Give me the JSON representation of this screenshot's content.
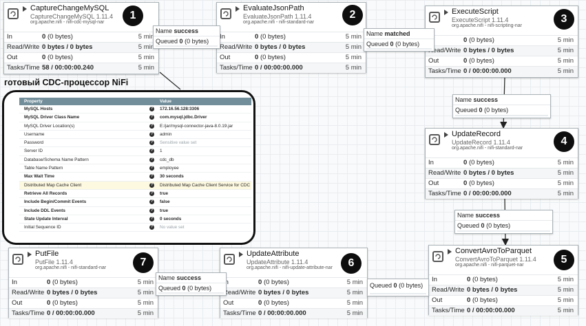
{
  "caption": "готовый CDC-процессор NiFi",
  "units": {
    "bytes": "(0 bytes)",
    "bytes_pair": "0 bytes / 0 bytes",
    "window": "5 min"
  },
  "row_labels": {
    "in": "In",
    "rw": "Read/Write",
    "out": "Out",
    "tasks": "Tasks/Time"
  },
  "queue_labels": {
    "name": "Name",
    "queued": "Queued"
  },
  "processors": [
    {
      "name": "CaptureChangeMySQL",
      "type": "CaptureChangeMySQL 1.11.4",
      "bundle": "org.apache.nifi - nifi-cdc-mysql-nar",
      "number": "1",
      "in": "0",
      "out": "0",
      "tasks": "58 / 00:00:00.240"
    },
    {
      "name": "EvaluateJsonPath",
      "type": "EvaluateJsonPath 1.11.4",
      "bundle": "org.apache.nifi - nifi-standard-nar",
      "number": "2",
      "in": "0",
      "out": "0",
      "tasks": "0 / 00:00:00.000"
    },
    {
      "name": "ExecuteScript",
      "type": "ExecuteScript 1.11.4",
      "bundle": "org.apache.nifi - nifi-scripting-nar",
      "number": "3",
      "in": "0",
      "out": "0",
      "tasks": "0 / 00:00:00.000"
    },
    {
      "name": "UpdateRecord",
      "type": "UpdateRecord 1.11.4",
      "bundle": "org.apache.nifi - nifi-standard-nar",
      "number": "4",
      "in": "0",
      "out": "0",
      "tasks": "0 / 00:00:00.000"
    },
    {
      "name": "ConvertAvroToParquet",
      "type": "ConvertAvroToParquet 1.11.4",
      "bundle": "org.apache.nifi - nifi-parquet-nar",
      "number": "5",
      "in": "0",
      "out": "0",
      "tasks": "0 / 00:00:00.000"
    },
    {
      "name": "UpdateAttribute",
      "type": "UpdateAttribute 1.11.4",
      "bundle": "org.apache.nifi - nifi-update-attribute-nar",
      "number": "6",
      "in": "0",
      "out": "0",
      "tasks": "0 / 00:00:00.000"
    },
    {
      "name": "PutFile",
      "type": "PutFile 1.11.4",
      "bundle": "org.apache.nifi - nifi-standard-nar",
      "number": "7",
      "in": "0",
      "out": "0",
      "tasks": "0 / 00:00:00.000"
    }
  ],
  "connections": [
    {
      "name": "success",
      "queued": "0",
      "queued_bytes": "(0 bytes)"
    },
    {
      "name": "matched",
      "queued": "0",
      "queued_bytes": "(0 bytes)"
    },
    {
      "name": "success",
      "queued": "0",
      "queued_bytes": "(0 bytes)"
    },
    {
      "name": "success",
      "queued": "0",
      "queued_bytes": "(0 bytes)"
    },
    {
      "name": "",
      "queued": "0",
      "queued_bytes": "(0 bytes)"
    },
    {
      "name": "success",
      "queued": "0",
      "queued_bytes": "(0 bytes)"
    }
  ],
  "properties": {
    "header_property": "Property",
    "header_value": "Value",
    "rows": [
      {
        "key": "MySQL Hosts",
        "value": "172.16.56.128:3306"
      },
      {
        "key": "MySQL Driver Class Name",
        "value": "com.mysql.jdbc.Driver"
      },
      {
        "key": "MySQL Driver Location(s)",
        "value": "E:/jar/mysql-connector-java-8.0.19.jar"
      },
      {
        "key": "Username",
        "value": "admin"
      },
      {
        "key": "Password",
        "value": "Sensitive value set"
      },
      {
        "key": "Server ID",
        "value": "1"
      },
      {
        "key": "Database/Schema Name Pattern",
        "value": "cdc_db"
      },
      {
        "key": "Table Name Pattern",
        "value": "employee"
      },
      {
        "key": "Max Wait Time",
        "value": "30 seconds"
      },
      {
        "key": "Distributed Map Cache Client",
        "value": "Distributed Map Cache Client Service for CDC"
      },
      {
        "key": "Retrieve All Records",
        "value": "true"
      },
      {
        "key": "Include Begin/Commit Events",
        "value": "false"
      },
      {
        "key": "Include DDL Events",
        "value": "true"
      },
      {
        "key": "State Update Interval",
        "value": "0 seconds"
      },
      {
        "key": "Initial Sequence ID",
        "value": "No value set"
      }
    ]
  }
}
